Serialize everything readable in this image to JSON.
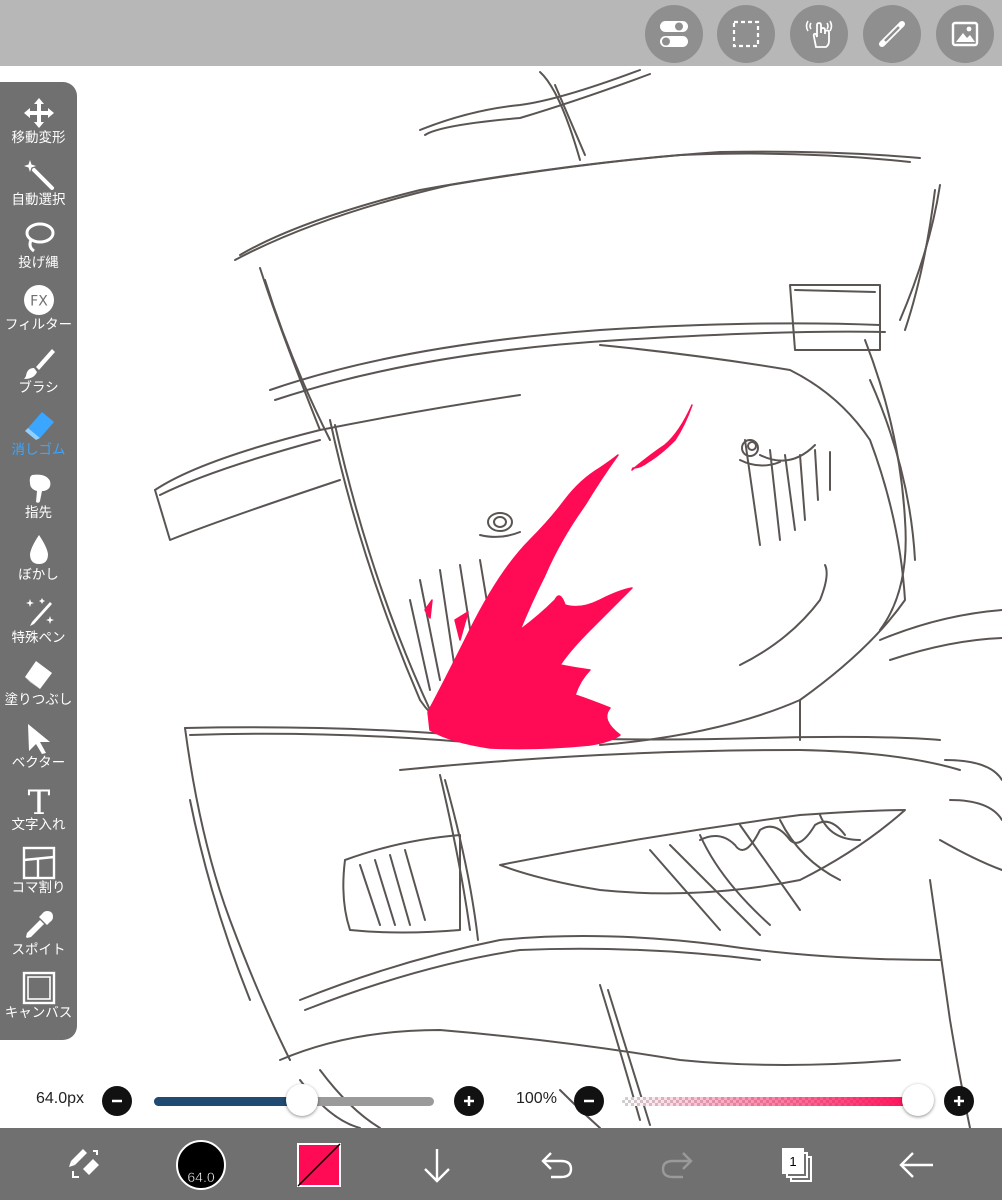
{
  "top_actions": [
    {
      "name": "toggle-icon"
    },
    {
      "name": "selection-icon"
    },
    {
      "name": "gesture-icon"
    },
    {
      "name": "ruler-icon"
    },
    {
      "name": "image-icon"
    }
  ],
  "tools": [
    {
      "label": "移動変形",
      "icon": "move-icon"
    },
    {
      "label": "自動選択",
      "icon": "magic-wand-icon"
    },
    {
      "label": "投げ縄",
      "icon": "lasso-icon"
    },
    {
      "label": "フィルター",
      "icon": "fx-icon",
      "fx_text": "FX"
    },
    {
      "label": "ブラシ",
      "icon": "brush-icon"
    },
    {
      "label": "消しゴム",
      "icon": "eraser-icon",
      "active": true
    },
    {
      "label": "指先",
      "icon": "finger-icon"
    },
    {
      "label": "ぼかし",
      "icon": "blur-icon"
    },
    {
      "label": "特殊ペン",
      "icon": "special-pen-icon"
    },
    {
      "label": "塗りつぶし",
      "icon": "fill-icon"
    },
    {
      "label": "ベクター",
      "icon": "vector-icon"
    },
    {
      "label": "文字入れ",
      "icon": "text-icon",
      "glyph": "T"
    },
    {
      "label": "コマ割り",
      "icon": "frame-divide-icon"
    },
    {
      "label": "スポイト",
      "icon": "eyedropper-icon"
    },
    {
      "label": "キャンバス",
      "icon": "canvas-icon"
    }
  ],
  "brush_size": {
    "value_text": "64.0px",
    "fraction": 0.53,
    "minus": "−",
    "plus": "+"
  },
  "opacity": {
    "value_text": "100%",
    "fraction": 1.0,
    "minus": "−",
    "plus": "+"
  },
  "bottom": {
    "brush_badge": "64.0",
    "color": "#ff0a54",
    "layer_count": "1"
  },
  "colors": {
    "accent": "#3aa6ff",
    "paint": "#ff0a54",
    "slider_blue": "#1f4a72",
    "sketch": "#5a5552"
  }
}
